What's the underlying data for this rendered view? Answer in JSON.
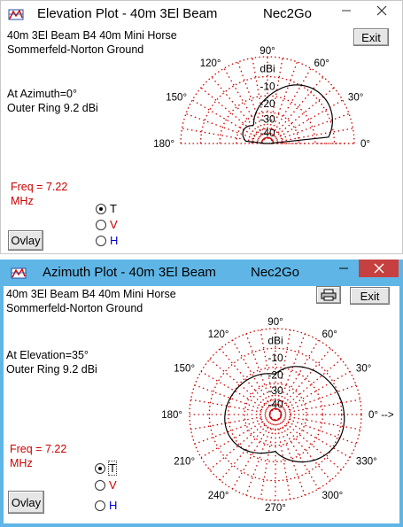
{
  "elevation_window": {
    "title": "Elevation Plot - 40m 3El Beam",
    "app_name": "Nec2Go",
    "exit_label": "Exit",
    "info_line1": "40m 3El Beam B4 40m Mini Horse",
    "info_line2": "Sommerfeld-Norton Ground",
    "azimuth_text": "At Azimuth=0°",
    "outer_ring_text": "Outer Ring 9.2 dBi",
    "freq_line1": "Freq = 7.22",
    "freq_line2": "MHz",
    "radio_options": [
      {
        "label": "T",
        "selected": true
      },
      {
        "label": "V",
        "selected": false
      },
      {
        "label": "H",
        "selected": false
      }
    ],
    "overlay_label": "Ovlay",
    "angle_labels": [
      "0°",
      "30°",
      "60°",
      "90°",
      "120°",
      "150°",
      "180°"
    ],
    "ring_labels": [
      "dBi",
      "-10",
      "-20",
      "-30",
      "-40"
    ]
  },
  "azimuth_window": {
    "title": "Azimuth Plot - 40m 3El Beam",
    "app_name": "Nec2Go",
    "exit_label": "Exit",
    "info_line1": "40m 3El Beam B4 40m Mini Horse",
    "info_line2": "Sommerfeld-Norton Ground",
    "elevation_text": "At Elevation=35°",
    "outer_ring_text": "Outer Ring 9.2 dBi",
    "freq_line1": "Freq = 7.22",
    "freq_line2": "MHz",
    "radio_options": [
      {
        "label": "T",
        "selected": true
      },
      {
        "label": "V",
        "selected": false
      },
      {
        "label": "H",
        "selected": false
      }
    ],
    "overlay_label": "Ovlay",
    "angle_labels": [
      "0° -->",
      "30°",
      "60°",
      "90°",
      "120°",
      "150°",
      "180°",
      "210°",
      "240°",
      "270°",
      "300°",
      "330°"
    ],
    "ring_labels": [
      "dBi",
      "-10",
      "-20",
      "-30",
      "-40"
    ]
  },
  "colors": {
    "grid_red": "#cc0000",
    "pattern": "#000000",
    "active_titlebar": "#5fb6e6",
    "close_red": "#c74040"
  }
}
